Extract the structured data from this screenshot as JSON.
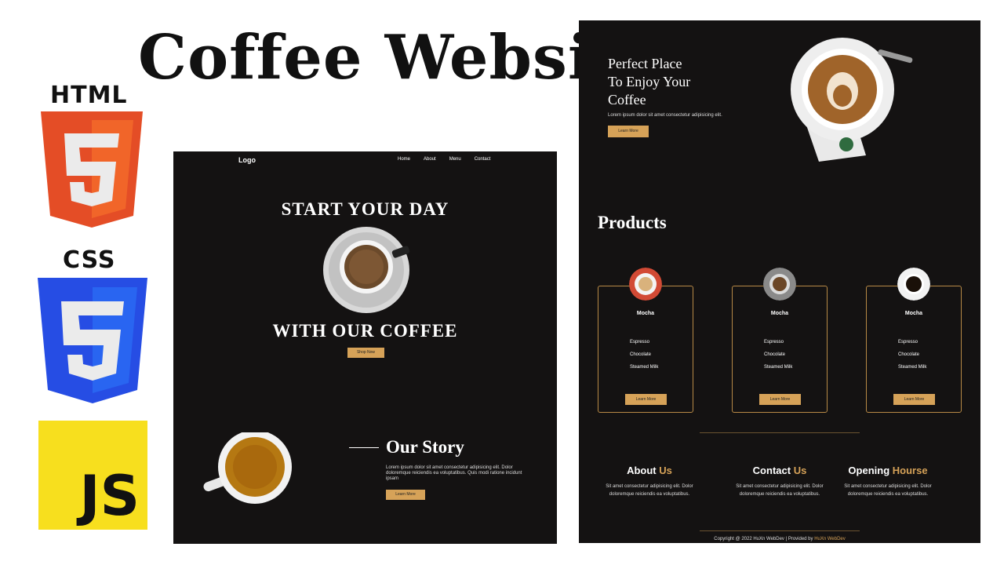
{
  "title": "Coffee Website",
  "badges": {
    "html": "HTML",
    "css": "CSS",
    "js": "JS"
  },
  "preview_left": {
    "logo": "Logo",
    "nav": [
      "Home",
      "About",
      "Menu",
      "Contact"
    ],
    "hero_line1": "START YOUR DAY",
    "hero_line2": "WITH OUR COFFEE",
    "shop_button": "Shop Now",
    "story_title": "Our Story",
    "story_text": "Lorem ipsum dolor sit amet consectetur adipisicing elit. Dolor doloremque reiciendis ea voluptatibus. Quis modi ratione incidunt ipsam",
    "learn_button": "Learn More"
  },
  "preview_right": {
    "hero_line1": "Perfect Place",
    "hero_line2": "To Enjoy Your",
    "hero_line3": "Coffee",
    "hero_text": "Lorem ipsum dolor sit amet consectetur adipisicing elit.",
    "hero_button": "Learn More",
    "products_title": "Products",
    "cards": [
      {
        "name": "Mocha",
        "items": [
          "Espresso",
          "Chocolate",
          "Steamed Milk"
        ],
        "button": "Learn More"
      },
      {
        "name": "Mocha",
        "items": [
          "Espresso",
          "Chocolate",
          "Steamed Milk"
        ],
        "button": "Learn More"
      },
      {
        "name": "Mocha",
        "items": [
          "Espresso",
          "Chocolate",
          "Steamed Milk"
        ],
        "button": "Learn More"
      }
    ],
    "footer": [
      {
        "title_a": "About",
        "title_b": "Us",
        "text": "Sit amet consectetur adipisicing elit. Dolor doloremque reiciendis ea voluptatibus."
      },
      {
        "title_a": "Contact",
        "title_b": "Us",
        "text": "Sit amet consectetur adipisicing elit. Dolor doloremque reiciendis ea voluptatibus."
      },
      {
        "title_a": "Opening",
        "title_b": "Hourse",
        "text": "Sit amet consectetur adipisicing elit. Dolor doloremque reiciendis ea voluptatibus."
      }
    ],
    "copyright": "Copyright @ 2022 HuXn WebDev | Provided by",
    "copyright_link": "HuXn WebDev"
  },
  "colors": {
    "accent": "#d6a258",
    "dark_bg": "#141212",
    "html_orange": "#e44d26",
    "css_blue": "#264de4",
    "js_yellow": "#f7df1e"
  }
}
